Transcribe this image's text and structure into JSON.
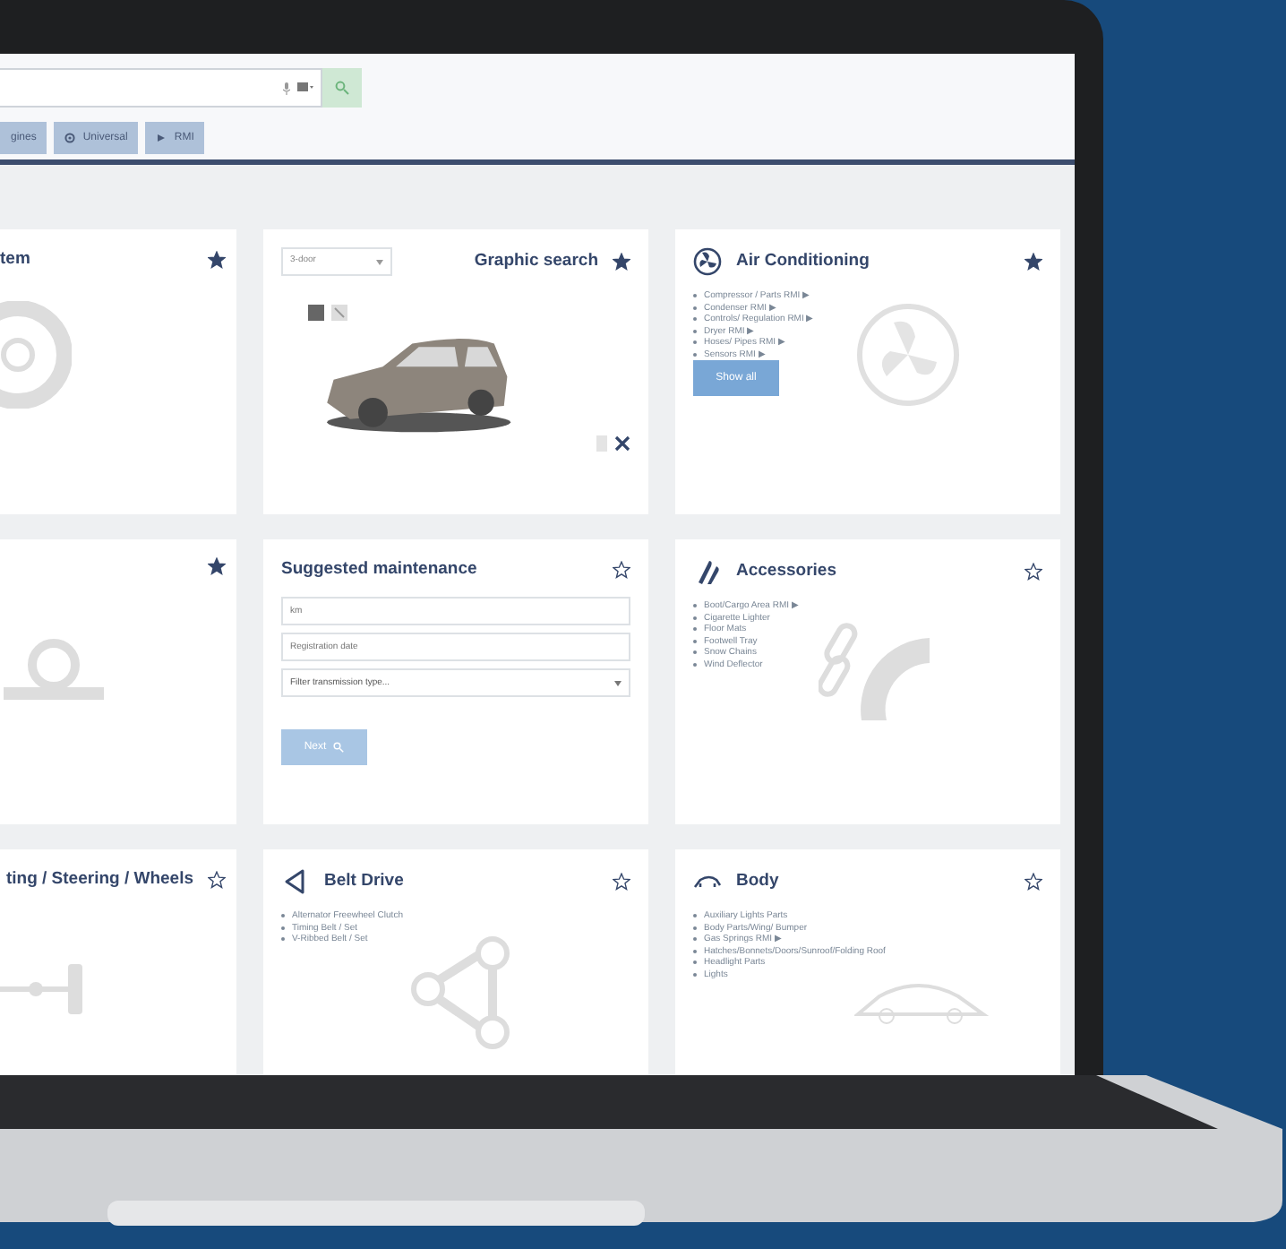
{
  "header": {
    "tabs": [
      {
        "label": "gines",
        "selected": false
      },
      {
        "label": "Universal",
        "selected": false
      },
      {
        "label": "RMI",
        "selected": false
      }
    ]
  },
  "cards": [
    {
      "kind": "list",
      "title": "tem",
      "favorite": true
    },
    {
      "kind": "graphic",
      "title": "Graphic search",
      "favorite": true,
      "select": "3-door"
    },
    {
      "kind": "list",
      "title": "Air Conditioning",
      "favorite": true,
      "items": [
        "Compressor / Parts RMI ▶",
        "Condenser RMI ▶",
        "Controls/ Regulation RMI ▶",
        "Dryer RMI ▶",
        "Hoses/ Pipes RMI ▶",
        "Sensors RMI ▶"
      ],
      "button": "Show all"
    },
    {
      "kind": "list",
      "favorite": true
    },
    {
      "kind": "form",
      "title": "Suggested maintenance",
      "favorite": false,
      "fields": [
        {
          "placeholder": "km"
        },
        {
          "placeholder": "Registration date"
        }
      ],
      "select": "Filter transmission type...",
      "button": "Next"
    },
    {
      "kind": "list",
      "title": "Accessories",
      "favorite": false,
      "items": [
        "Boot/Cargo Area RMI ▶",
        "Cigarette Lighter",
        "Floor Mats",
        "Footwell Tray",
        "Snow Chains",
        "Wind Deflector"
      ]
    },
    {
      "kind": "list",
      "title": "ting / Steering / Wheels",
      "favorite": false
    },
    {
      "kind": "list",
      "title": "Belt Drive",
      "favorite": false,
      "items": [
        "Alternator Freewheel Clutch",
        "Timing Belt / Set",
        "V-Ribbed Belt / Set"
      ]
    },
    {
      "kind": "list",
      "title": "Body",
      "favorite": false,
      "items": [
        "Auxiliary Lights Parts",
        "Body Parts/Wing/ Bumper",
        "Gas Springs RMI ▶",
        "Hatches/Bonnets/Doors/Sunroof/Folding Roof",
        "Headlight Parts",
        "Lights"
      ]
    }
  ]
}
